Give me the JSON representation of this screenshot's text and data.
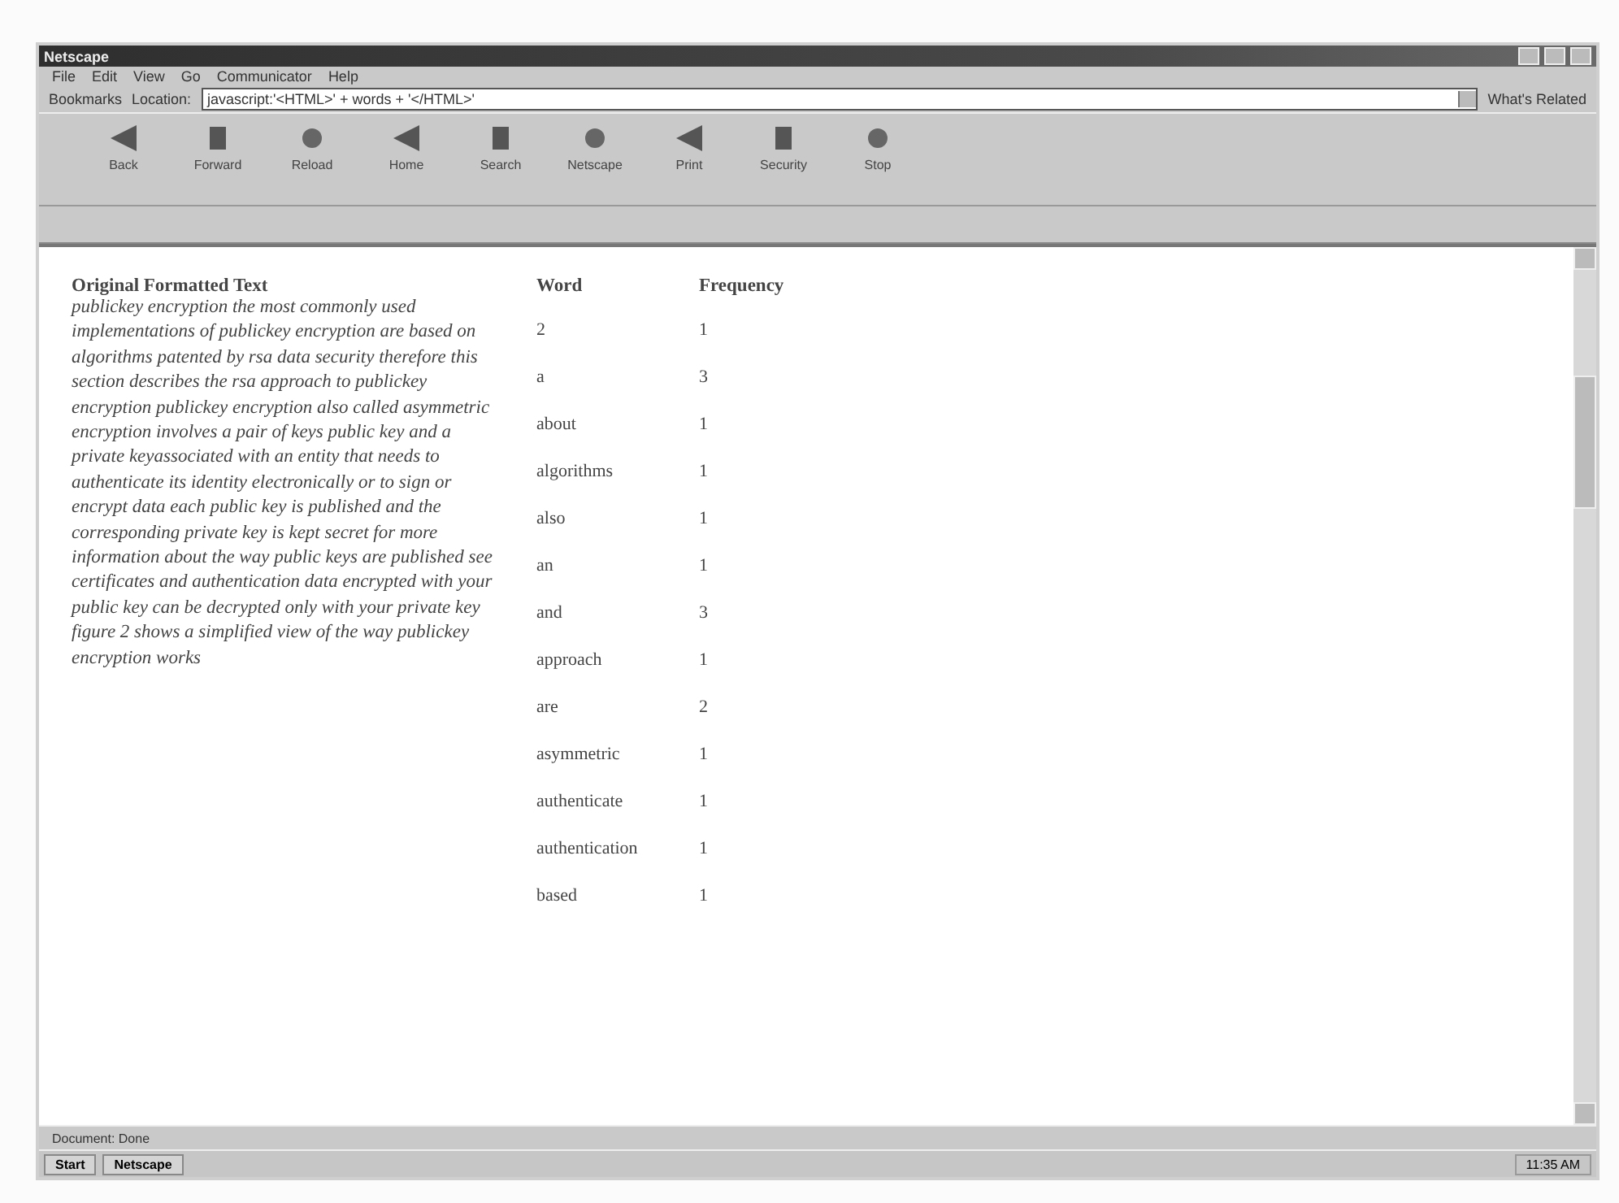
{
  "window": {
    "title": "Netscape"
  },
  "menu": [
    "File",
    "Edit",
    "View",
    "Go",
    "Communicator",
    "Help"
  ],
  "location_bar": {
    "bookmarks": "Bookmarks",
    "label": "Location:",
    "value": "javascript:'<HTML>' + words + '</HTML>'",
    "related": "What's Related"
  },
  "toolbar": [
    "Back",
    "Forward",
    "Reload",
    "Home",
    "Search",
    "Netscape",
    "Print",
    "Security",
    "Stop"
  ],
  "content": {
    "heading": "Original Formatted Text",
    "paragraph": "publickey encryption the most commonly used implementations of publickey encryption are based on algorithms patented by rsa data security therefore this section describes the rsa approach to publickey encryption publickey encryption also called asymmetric encryption involves a pair of keys public key and a private keyassociated with an entity that needs to authenticate its identity electronically or to sign or encrypt data each public key is published and the corresponding private key is kept secret for more information about the way public keys are published see certificates and authentication data encrypted with your public key can be decrypted only with your private key figure 2 shows a simplified view of the way publickey encryption works"
  },
  "table": {
    "columns": [
      "Word",
      "Frequency"
    ],
    "rows": [
      [
        "2",
        "1"
      ],
      [
        "a",
        "3"
      ],
      [
        "about",
        "1"
      ],
      [
        "algorithms",
        "1"
      ],
      [
        "also",
        "1"
      ],
      [
        "an",
        "1"
      ],
      [
        "and",
        "3"
      ],
      [
        "approach",
        "1"
      ],
      [
        "are",
        "2"
      ],
      [
        "asymmetric",
        "1"
      ],
      [
        "authenticate",
        "1"
      ],
      [
        "authentication",
        "1"
      ],
      [
        "based",
        "1"
      ]
    ]
  },
  "status_bar": {
    "text": "Document: Done"
  },
  "taskbar": {
    "start": "Start",
    "tasks": [
      "Netscape"
    ],
    "clock": "11:35 AM"
  }
}
